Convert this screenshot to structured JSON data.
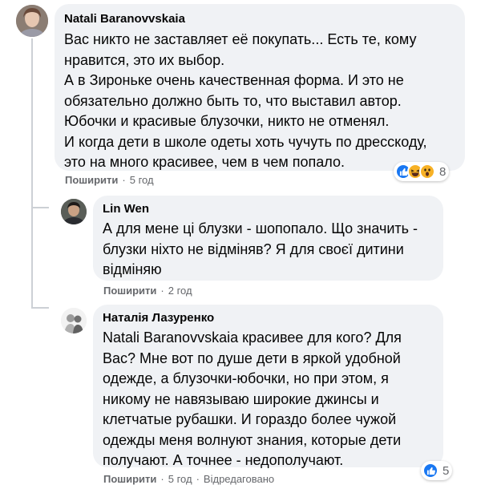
{
  "comments": [
    {
      "author": "Natali Baranovvskaia",
      "text": "Вас никто не заставляет её покупать... Есть те, кому\nнравится, это их выбор.\nА в Зироньке очень качественная форма. И это не\nобязательно должно быть то, что выставил автор.\nЮбочки и красивые блузочки, никто не отменял.\nИ когда дети в школе одеты хоть чучуть по дресскоду,\nэто на много красивее, чем в чем попало.",
      "action": "Поширити",
      "time": "5 год",
      "reaction_count": "8",
      "reaction_icons": [
        "like-icon",
        "laugh-icon",
        "wow-icon"
      ],
      "colors": {
        "like": "#1877f2",
        "laugh": "#f7b125",
        "wow": "#f7b125"
      }
    },
    {
      "author": "Lin Wen",
      "text": "А для мене ці блузки - шопопало. Що значить -\nблузки ніхто не відміняв? Я для своєї дитини\nвідміняю",
      "action": "Поширити",
      "time": "2 год"
    },
    {
      "author": "Наталія Лазуренко",
      "text": "Natali Baranovvskaia красивее для кого? Для\nВас? Мне вот по душе дети в яркой удобной\nодежде, а блузочки-юбочки, но при этом, я\nникому не навязываю широкие джинсы и\nклетчатые рубашки. И гораздо более чужой\nодежды меня волнуют знания, которые дети\nполучают. А точнее - недополучают.",
      "action": "Поширити",
      "time": "5 год",
      "edited": "Відредаговано",
      "reaction_count": "5",
      "reaction_icons": [
        "like-icon"
      ],
      "colors": {
        "like": "#1877f2"
      }
    }
  ],
  "separator": "·"
}
